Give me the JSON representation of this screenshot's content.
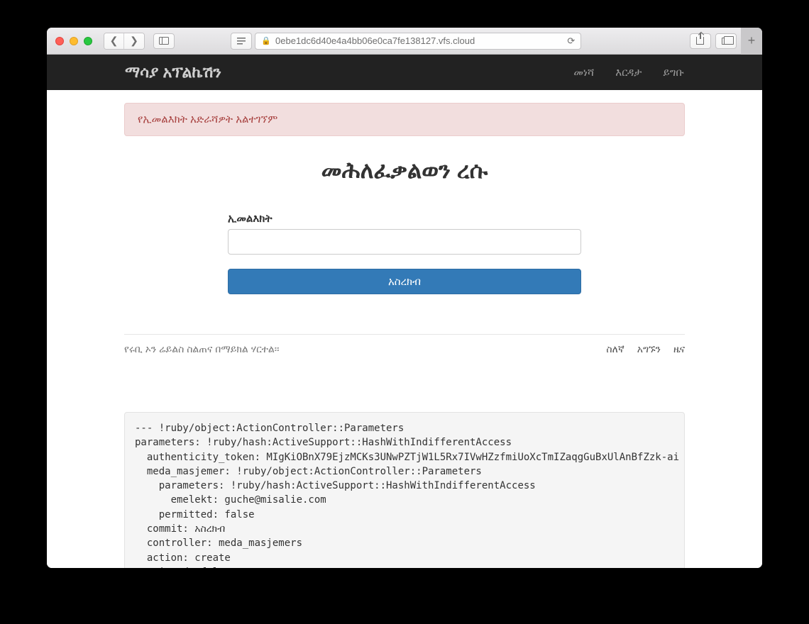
{
  "browser": {
    "url": "0ebe1dc6d40e4a4bb06e0ca7fe138127.vfs.cloud"
  },
  "navbar": {
    "brand": "ማሳያ አፕልኬሽን",
    "links": [
      "መነሻ",
      "እርዳታ",
      "ይግቡ"
    ]
  },
  "alert": "የኢመልእክት አድራሻዎት አልተገኘም",
  "title": "መሕለፈቃልወን ረሱ",
  "form": {
    "email_label": "ኢመልእክት",
    "email_value": "",
    "submit": "አስረክብ"
  },
  "footer": {
    "credit": "የሩቢ ኦን ሬይልስ ስልጠና በማይክል ሃርተል፡፡",
    "links": [
      "ስለኛ",
      "አግኙን",
      "ዜና"
    ]
  },
  "debug": "--- !ruby/object:ActionController::Parameters\nparameters: !ruby/hash:ActiveSupport::HashWithIndifferentAccess\n  authenticity_token: MIgKiOBnX79EjzMCKs3UNwPZTjW1L5Rx7IVwHZzfmiUoXcTmIZaqgGuBxUlAnBfZzk-ai\n  meda_masjemer: !ruby/object:ActionController::Parameters\n    parameters: !ruby/hash:ActiveSupport::HashWithIndifferentAccess\n      emelekt: guche@misalie.com\n    permitted: false\n  commit: አስረክብ\n  controller: meda_masjemers\n  action: create\npermitted: false"
}
